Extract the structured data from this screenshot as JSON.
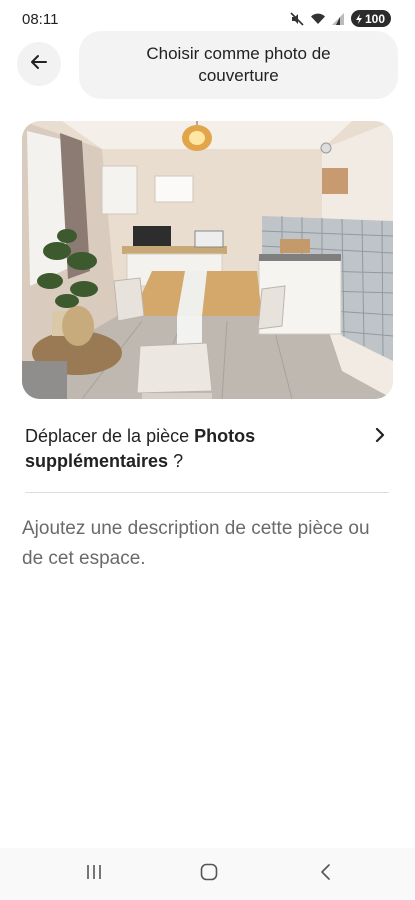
{
  "status_bar": {
    "time": "08:11",
    "battery": "100",
    "icons": [
      "mute-icon",
      "wifi-icon",
      "signal-icon",
      "battery-icon"
    ]
  },
  "header": {
    "back_icon": "arrow-left-icon",
    "title": "Choisir comme photo de couverture"
  },
  "photo": {
    "subject": "room-photo"
  },
  "move_row": {
    "prefix": "Déplacer de la pièce ",
    "room": "Photos supplémentaires",
    "suffix": " ?",
    "chevron_icon": "chevron-right-icon"
  },
  "description": {
    "placeholder": "Ajoutez une description de cette pièce ou de cet espace."
  },
  "nav_bar": {
    "icons": [
      "recent-apps-icon",
      "home-icon",
      "back-icon"
    ]
  },
  "colors": {
    "text": "#222222",
    "muted": "#6a6a6a",
    "pill": "#f3f3f3",
    "divider": "#dddddd"
  }
}
